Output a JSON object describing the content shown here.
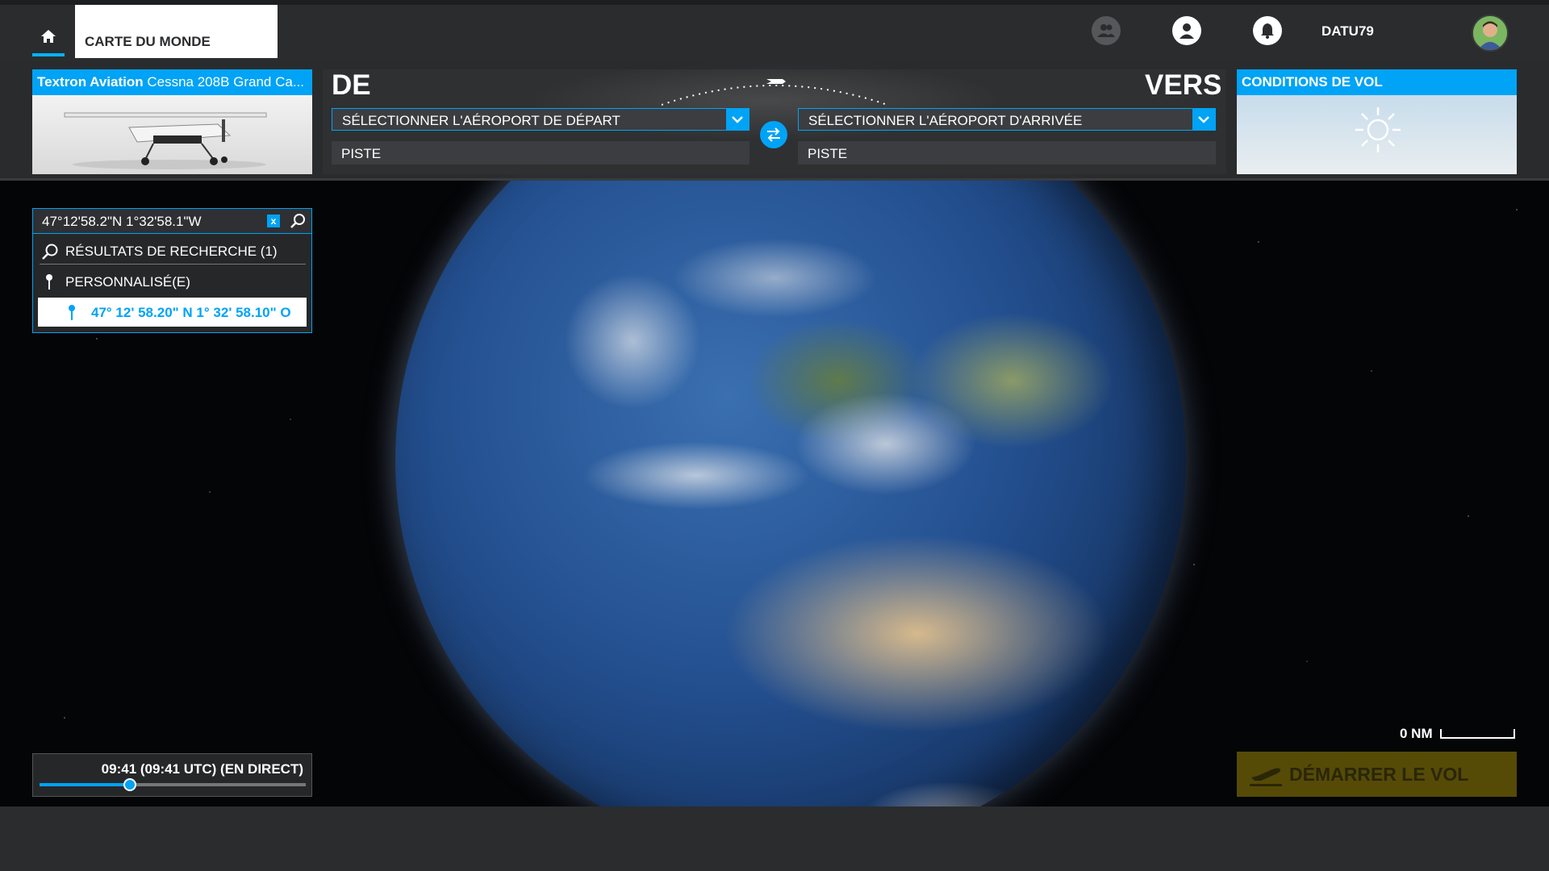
{
  "topbar": {
    "home_label": "home",
    "tab_world_map": "CARTE DU MONDE",
    "username": "DATU79",
    "icons": [
      "friends-icon",
      "profile-icon",
      "notifications-icon"
    ]
  },
  "aircraft": {
    "brand": "Textron Aviation",
    "model": "Cessna 208B Grand Ca..."
  },
  "route": {
    "from_label": "DE",
    "to_label": "VERS",
    "departure_placeholder": "SÉLECTIONNER L'AÉROPORT DE DÉPART",
    "arrival_placeholder": "SÉLECTIONNER L'AÉROPORT D'ARRIVÉE",
    "departure_runway": "PISTE",
    "arrival_runway": "PISTE"
  },
  "conditions": {
    "title": "CONDITIONS DE VOL",
    "weather_icon": "sun-icon"
  },
  "search": {
    "query": "47°12'58.2\"N 1°32'58.1\"W",
    "clear_label": "x",
    "results_header": "RÉSULTATS DE RECHERCHE (1)",
    "category": "PERSONNALISÉ(E)",
    "results": [
      "47° 12' 58.20\" N 1° 32' 58.10\" O"
    ]
  },
  "time": {
    "label": "09:41 (09:41 UTC) (EN DIRECT)",
    "slider_fraction": 0.335
  },
  "map": {
    "scale_label": "0 NM"
  },
  "start_flight": {
    "label": "DÉMARRER LE VOL"
  },
  "colors": {
    "accent": "#00a3f5",
    "start_button": "#5f5208"
  }
}
